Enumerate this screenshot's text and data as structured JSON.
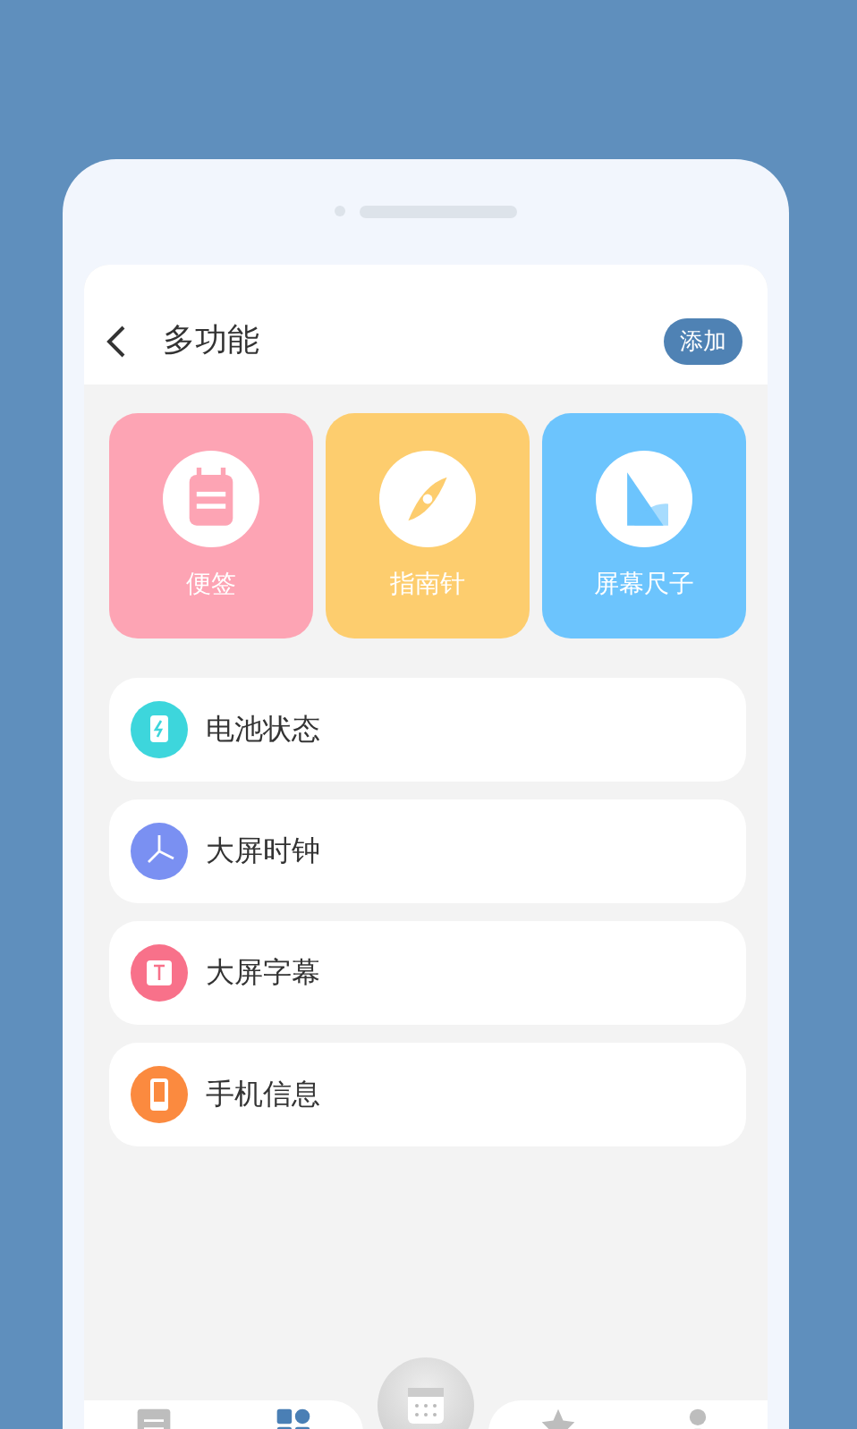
{
  "header": {
    "title": "多功能",
    "action": "添加"
  },
  "tiles": [
    {
      "label": "便签",
      "kind": "note",
      "color": "#fda4b4"
    },
    {
      "label": "指南针",
      "kind": "compass",
      "color": "#fdcd6e"
    },
    {
      "label": "屏幕尺子",
      "kind": "ruler",
      "color": "#6cc4fd"
    }
  ],
  "items": [
    {
      "label": "电池状态",
      "kind": "battery",
      "color": "#3dd6dc"
    },
    {
      "label": "大屏时钟",
      "kind": "clock",
      "color": "#7a90f2"
    },
    {
      "label": "大屏字幕",
      "kind": "caption",
      "color": "#f8718a"
    },
    {
      "label": "手机信息",
      "kind": "phone",
      "color": "#fb8a3f"
    }
  ],
  "nav": [
    {
      "kind": "convert",
      "selected": false
    },
    {
      "kind": "grid",
      "selected": true
    },
    {
      "kind": "star",
      "selected": false
    },
    {
      "kind": "person",
      "selected": false
    }
  ]
}
